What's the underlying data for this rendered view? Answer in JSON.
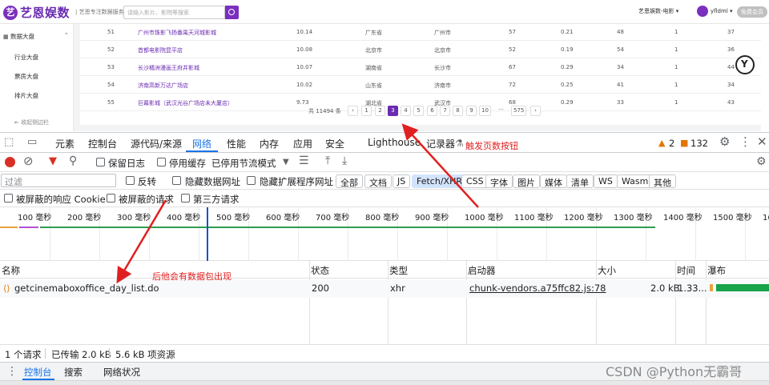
{
  "site": {
    "logo_mark": "艺",
    "logo_text": "艺恩娱数",
    "slogan": "| 艺恩专注数据服务14年",
    "search_placeholder": "请输入影片、影院等搜索",
    "nav_label": "艺恩娱数-电影 ▾",
    "user": "yfldml ▾",
    "upgrade": "免费会员",
    "sidebar": {
      "section": "数据大盘",
      "items": [
        "行业大盘",
        "票房大盘",
        "排片大盘"
      ],
      "collapse": "收起侧边栏"
    },
    "table_rows": [
      [
        "51",
        "广州市珠影飞扬番禺天河城影城",
        "10.14",
        "广东省",
        "广州市",
        "57",
        "0.21",
        "48",
        "1",
        "37"
      ],
      [
        "52",
        "首都电影院昆平店",
        "10.08",
        "北京市",
        "北京市",
        "52",
        "0.19",
        "54",
        "1",
        "36"
      ],
      [
        "53",
        "长沙橘洲漫画王府井影城",
        "10.07",
        "湖南省",
        "长沙市",
        "67",
        "0.29",
        "34",
        "1",
        "44"
      ],
      [
        "54",
        "济南高新万达广场店",
        "10.02",
        "山东省",
        "济南市",
        "72",
        "0.25",
        "41",
        "1",
        "34"
      ],
      [
        "55",
        "巨幕影城（武汉光谷广场店未大厦店）",
        "9.73",
        "湖北省",
        "武汉市",
        "68",
        "0.29",
        "33",
        "1",
        "43"
      ]
    ],
    "pager": {
      "total": "共 11494 条",
      "prev": "‹",
      "pages": [
        "1",
        "2",
        "3",
        "4",
        "5",
        "6",
        "7",
        "8",
        "9",
        "10",
        "···",
        "575"
      ],
      "active": "3",
      "next": "›"
    }
  },
  "devtools": {
    "tabs": [
      "元素",
      "控制台",
      "源代码/来源",
      "网络",
      "性能",
      "内存",
      "应用",
      "安全",
      "Lighthouse",
      "记录器"
    ],
    "active_tab": "网络",
    "warnings": "2",
    "issues": "132",
    "toolbar": {
      "preserve_log": "保留日志",
      "disable_cache": "停用缓存",
      "throttle": "已停用节流模式"
    },
    "filter": {
      "placeholder": "过滤",
      "invert": "反转",
      "hide_data_urls": "隐藏数据网址",
      "hide_ext_urls": "隐藏扩展程序网址",
      "chips": [
        "全部",
        "文档",
        "JS",
        "Fetch/XHR",
        "CSS",
        "字体",
        "图片",
        "媒体",
        "清单",
        "WS",
        "Wasm",
        "其他"
      ],
      "active_chip": "Fetch/XHR"
    },
    "options": {
      "blocked_cookies": "被屏蔽的响应 Cookie",
      "blocked_requests": "被屏蔽的请求",
      "third_party": "第三方请求"
    },
    "timeline_ticks": [
      "100 毫秒",
      "200 毫秒",
      "300 毫秒",
      "400 毫秒",
      "500 毫秒",
      "600 毫秒",
      "700 毫秒",
      "800 毫秒",
      "900 毫秒",
      "1000 毫秒",
      "1100 毫秒",
      "1200 毫秒",
      "1300 毫秒",
      "1400 毫秒",
      "1500 毫秒",
      "1600 毫"
    ],
    "columns": [
      "名称",
      "状态",
      "类型",
      "启动器",
      "大小",
      "时间",
      "瀑布"
    ],
    "request": {
      "name": "getcinemaboxoffice_day_list.do",
      "status": "200",
      "type": "xhr",
      "initiator": "chunk-vendors.a75ffc82.js:78",
      "size": "2.0 kB",
      "time": "1.33..."
    },
    "status_bar": {
      "requests": "1 个请求",
      "transferred": "已传输 2.0 kB",
      "resources": "5.6 kB 项资源"
    },
    "drawer_tabs": [
      "控制台",
      "搜索",
      "网络状况"
    ]
  },
  "annotations": {
    "trigger": "触发页数按钮",
    "packet": "后他会有数据包出现"
  },
  "watermark": "CSDN @Python无霸哥",
  "colors": {
    "brand": "#6a2bb0",
    "devtools_active": "#1a73e8",
    "annotation": "#e02020"
  }
}
